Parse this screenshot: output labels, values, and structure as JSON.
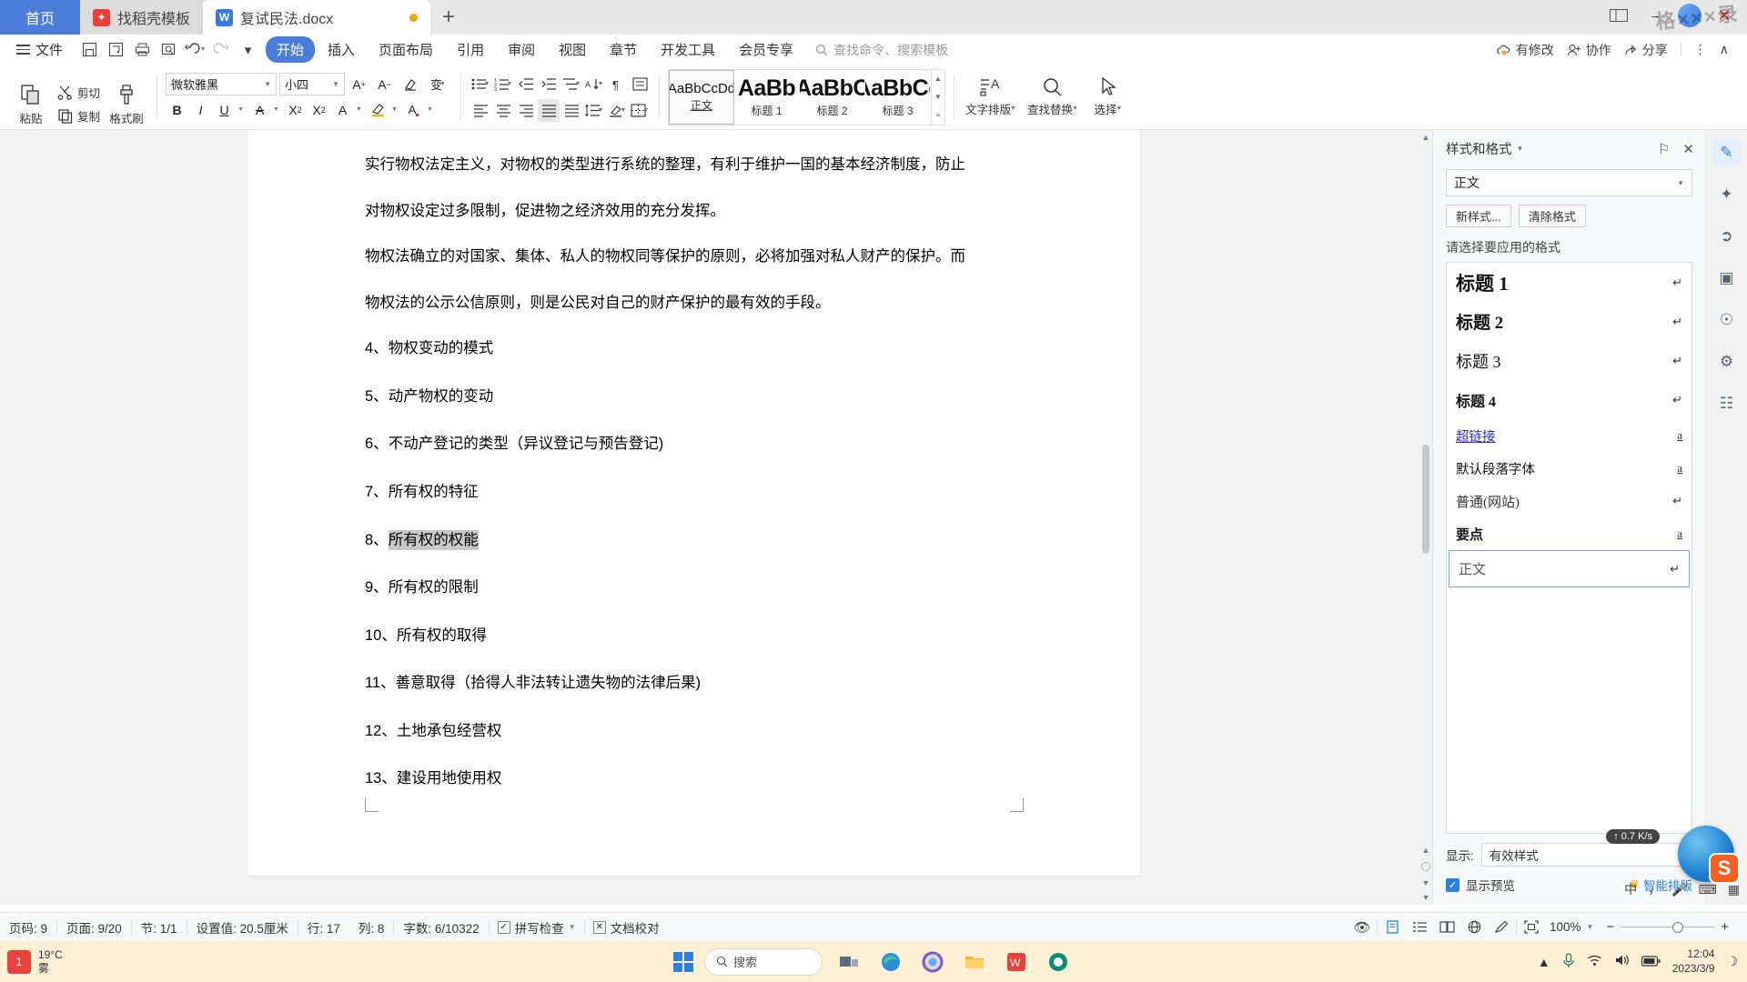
{
  "tabs": {
    "home_label": "首页",
    "items": [
      {
        "label": "找稻壳模板",
        "icon": "daoke-icon",
        "state": "inactive",
        "icon_glyph": "⬢"
      },
      {
        "label": "复试民法.docx",
        "icon": "wps-word-icon",
        "state": "active",
        "icon_glyph": "W"
      }
    ],
    "new_tab": "+",
    "window_buttons": [
      "minimize",
      "maximize",
      "close"
    ],
    "close_glyph": "✕"
  },
  "menubar": {
    "file_label": "文件",
    "quick_access": [
      "save-icon",
      "save-as-icon",
      "print-icon",
      "print-preview-icon",
      "undo-icon",
      "redo-icon",
      "customize-icon"
    ],
    "items": [
      "开始",
      "插入",
      "页面布局",
      "引用",
      "审阅",
      "视图",
      "章节",
      "开发工具",
      "会员专享"
    ],
    "active_item": "开始",
    "search_placeholder": "查找命令、搜索模板",
    "right_items": [
      {
        "label": "有修改",
        "icon": "cloud-sync-icon"
      },
      {
        "label": "协作",
        "icon": "collaborate-icon"
      },
      {
        "label": "分享",
        "icon": "share-icon"
      }
    ],
    "more_glyph": "⋮",
    "collapse_glyph": "∧"
  },
  "ribbon": {
    "clipboard": {
      "paste": "粘贴",
      "cut": "剪切",
      "copy": "复制",
      "format_painter": "格式刷"
    },
    "font": {
      "family": "微软雅黑",
      "size": "小四",
      "grow_label": "A",
      "shrink_label": "A",
      "buttons": [
        "B",
        "I",
        "U",
        "A",
        "X²",
        "X₂",
        "A"
      ]
    },
    "styles_gallery": [
      {
        "preview": "AaBbCcDd",
        "label": "正文",
        "selected": true
      },
      {
        "preview": "AaBb",
        "label": "标题 1",
        "selected": false
      },
      {
        "preview": "AaBbC",
        "label": "标题 2",
        "selected": false
      },
      {
        "preview": "AaBbCc",
        "label": "标题 3",
        "selected": false
      }
    ],
    "tools": [
      {
        "label": "文字排版",
        "icon": "text-layout-icon"
      },
      {
        "label": "查找替换",
        "icon": "find-replace-icon"
      },
      {
        "label": "选择",
        "icon": "select-cursor-icon"
      }
    ]
  },
  "document": {
    "paragraphs": [
      {
        "text": "实行物权法定主义，对物权的类型进行系统的整理，有利于维护一国的基本经济制度，防止",
        "highlight": false
      },
      {
        "text": "对物权设定过多限制，促进物之经济效用的充分发挥。",
        "highlight": false
      },
      {
        "text": "物权法确立的对国家、集体、私人的物权同等保护的原则，必将加强对私人财产的保护。而",
        "highlight": false
      },
      {
        "text": "物权法的公示公信原则，则是公民对自己的财产保护的最有效的手段。",
        "highlight": false
      }
    ],
    "list_items": [
      {
        "num": "4、",
        "text": "物权变动的模式",
        "highlight": false
      },
      {
        "num": "5、",
        "text": "动产物权的变动",
        "highlight": false
      },
      {
        "num": "6、",
        "text": "不动产登记的类型（异议登记与预告登记)",
        "highlight": false
      },
      {
        "num": "7、",
        "text": "所有权的特征",
        "highlight": false
      },
      {
        "num": "8、",
        "text": "所有权的权能",
        "highlight": true
      },
      {
        "num": "9、",
        "text": "所有权的限制",
        "highlight": false
      },
      {
        "num": "10、",
        "text": "所有权的取得",
        "highlight": false
      },
      {
        "num": "11、",
        "text": "善意取得（拾得人非法转让遗失物的法律后果)",
        "highlight": false
      },
      {
        "num": "12、",
        "text": "土地承包经营权",
        "highlight": false
      },
      {
        "num": "13、",
        "text": "建设用地使用权",
        "highlight": false
      }
    ]
  },
  "right_panel": {
    "title": "样式和格式",
    "pin_glyph": "⚐",
    "close_glyph": "✕",
    "current_style": "正文",
    "new_style_button": "新样式...",
    "clear_format_button": "清除格式",
    "hint": "请选择要应用的格式",
    "styles": [
      {
        "label": "标题 1",
        "mark": "↵",
        "kind": "h1"
      },
      {
        "label": "标题 2",
        "mark": "↵",
        "kind": "h2"
      },
      {
        "label": "标题 3",
        "mark": "↵",
        "kind": "h3"
      },
      {
        "label": "标题 4",
        "mark": "↵",
        "kind": "h4"
      },
      {
        "label": "超链接",
        "mark": "a",
        "kind": "link"
      },
      {
        "label": "默认段落字体",
        "mark": "a",
        "kind": "plain"
      },
      {
        "label": "普通(网站)",
        "mark": "↵",
        "kind": "web"
      },
      {
        "label": "要点",
        "mark": "a",
        "kind": "bold"
      },
      {
        "label": "正文",
        "mark": "↵",
        "kind": "normal",
        "selected": true
      }
    ],
    "show_label": "显示:",
    "show_value": "有效样式",
    "preview_checkbox_label": "显示预览",
    "preview_checked": true,
    "smart_layout": "智能排版",
    "rail_icons": [
      "edit-pen-icon",
      "magic-wand-icon",
      "cursor-select-icon",
      "image-icon",
      "help-icon",
      "shield-icon",
      "book-icon",
      "more-dots-icon"
    ]
  },
  "statusbar": {
    "items": [
      "页码: 9",
      "页面: 9/20",
      "节: 1/1",
      "设置值: 20.5厘米",
      "行: 17",
      "列: 8",
      "字数: 6/10322"
    ],
    "spell_check": "拼写检查",
    "doc_proof": "文档校对",
    "view_icons": [
      "eye-icon",
      "page-view-icon",
      "outline-view-icon",
      "web-view-icon",
      "read-view-icon",
      "pen-view-icon"
    ],
    "zoom": "100%",
    "zoom_minus": "−",
    "zoom_plus": "+"
  },
  "taskbar": {
    "weather_temp": "19°C",
    "weather_desc": "雾",
    "weather_badge": "1",
    "search_placeholder": "搜索",
    "apps": [
      "task-view-icon",
      "edge-browser-icon",
      "chrome-browser-icon",
      "file-explorer-icon",
      "wps-office-icon",
      "app-green-icon"
    ],
    "tray_icons": [
      "chevron-up-icon",
      "microphone-icon",
      "wifi-icon",
      "speaker-icon",
      "battery-icon"
    ],
    "time": "12:04",
    "date": "2023/3/9",
    "moon_glyph": "☽"
  },
  "floating": {
    "net_speed": "0.7 K/s",
    "ime_mode": "中",
    "ime_punct": "，",
    "ime_icons": [
      "microphone-icon",
      "keyboard-icon",
      "grid-icon"
    ],
    "sogou_letter": "S"
  },
  "watermark": "格×××录"
}
